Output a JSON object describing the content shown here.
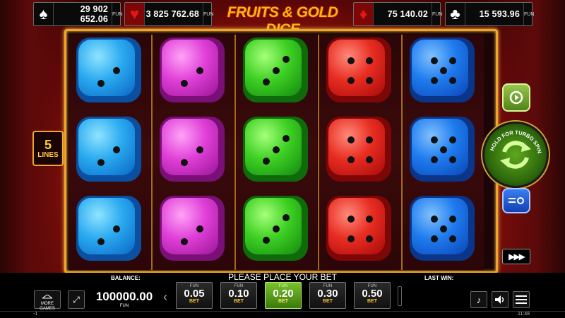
{
  "jackpots": [
    {
      "suit": "spade",
      "symbol": "♠",
      "value": "29 902 652.06",
      "currency": "FUN"
    },
    {
      "suit": "heart",
      "symbol": "♥",
      "value": "3 825 762.68",
      "currency": "FUN"
    },
    {
      "suit": "diamond",
      "symbol": "♦",
      "value": "75 140.02",
      "currency": "FUN"
    },
    {
      "suit": "club",
      "symbol": "♣",
      "value": "15 593.96",
      "currency": "FUN"
    }
  ],
  "logo": {
    "text": "FRUITS & GOLD DICE"
  },
  "lines": {
    "count": "5",
    "label": "LINES"
  },
  "reels": [
    {
      "color": "blue",
      "dice": [
        2,
        2,
        2
      ]
    },
    {
      "color": "magenta",
      "dice": [
        2,
        2,
        2
      ]
    },
    {
      "color": "green",
      "dice": [
        3,
        3,
        3
      ]
    },
    {
      "color": "red",
      "dice": [
        4,
        4,
        4
      ]
    },
    {
      "color": "blue",
      "dice": [
        5,
        5,
        5
      ]
    }
  ],
  "controls": {
    "turbo_label": "HOLD FOR TURBO SPIN",
    "autoplay_icon": "autoplay-icon",
    "spin_icon": "spin-arrows-icon",
    "settings_icon": "settings-icon",
    "fast_forward": "▶▶▶"
  },
  "bottom": {
    "balance_label": "BALANCE:",
    "message": "PLEASE PLACE YOUR BET",
    "last_win_label": "LAST WIN:",
    "more_games": "MORE GAMES",
    "balance_value": "100000.00",
    "balance_currency": "FUN",
    "bets": [
      {
        "currency": "FUN",
        "value": "0.05",
        "label": "BET",
        "selected": false
      },
      {
        "currency": "FUN",
        "value": "0.10",
        "label": "BET",
        "selected": false
      },
      {
        "currency": "FUN",
        "value": "0.20",
        "label": "BET",
        "selected": true
      },
      {
        "currency": "FUN",
        "value": "0.30",
        "label": "BET",
        "selected": false
      },
      {
        "currency": "FUN",
        "value": "0.50",
        "label": "BET",
        "selected": false
      }
    ],
    "status_left": "-1",
    "clock": "11:48"
  }
}
